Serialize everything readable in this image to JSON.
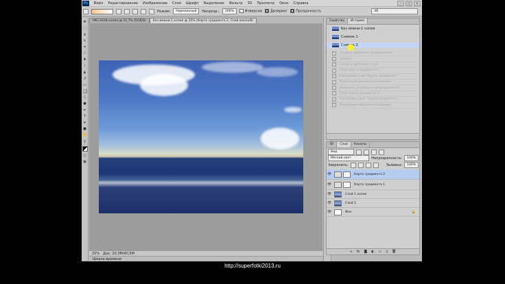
{
  "app": {
    "logo": "Ps"
  },
  "menu": [
    "Файл",
    "Редактирование",
    "Изображение",
    "Слои",
    "Шрифт",
    "Выделение",
    "Фильтр",
    "3D",
    "Просмотр",
    "Окно",
    "Справка"
  ],
  "options": {
    "mode_label": "Режим:",
    "mode_value": "Нормальный",
    "opacity_label": "Непрозр.:",
    "opacity_value": "100%",
    "inverse_label": "Инверсия",
    "dither_label": "Дизеринг",
    "transparency_label": "Прозрачность",
    "workspace": "3D"
  },
  "doc_tabs": [
    {
      "label": "IMG 9338 копия @ 22,7% (RGB/8)"
    },
    {
      "label": "Без имени-1 копия @ 25% (Карта градиента 2, Слой маска/8)"
    }
  ],
  "status": {
    "zoom": "25%",
    "doc": "Док: 20,3M/40,5M"
  },
  "timeline_label": "Шкала времени",
  "history_panel": {
    "tabs": [
      "Свойства",
      "История"
    ],
    "snapshots": [
      "Без имени-1 копия",
      "Снимок 1",
      "Снимок 2"
    ],
    "items": [
      "Создать дубликат изображения",
      "Уровни",
      "Создать дубликат слоя",
      "Слой Карта градиента 1",
      "Настройка слоя \"Карта градиента\"",
      "Изменение режима наложения",
      "Изменить всеобщую непрозрачность",
      "Слой Карта градиента 2",
      "Настройка слоя \"Карта градиента\"",
      "Изменение режима наложения"
    ]
  },
  "layers_panel": {
    "tabs": [
      "3D",
      "Слои",
      "Каналы"
    ],
    "filter_label": "Вид",
    "blend_mode": "Мягкий свет",
    "opacity_label": "Непрозрачность:",
    "opacity_value": "100%",
    "lock_label": "Закрепить:",
    "fill_label": "Заливка:",
    "fill_value": "100%",
    "layers": [
      {
        "name": "Карта градиента 2",
        "selected": true
      },
      {
        "name": "Карта градиента 1",
        "selected": false
      },
      {
        "name": "Слой 1 копия",
        "selected": false
      },
      {
        "name": "Слой 1",
        "selected": false
      },
      {
        "name": "Фон",
        "selected": false
      }
    ]
  },
  "watermark_url": "http://superfotki2013.ru"
}
